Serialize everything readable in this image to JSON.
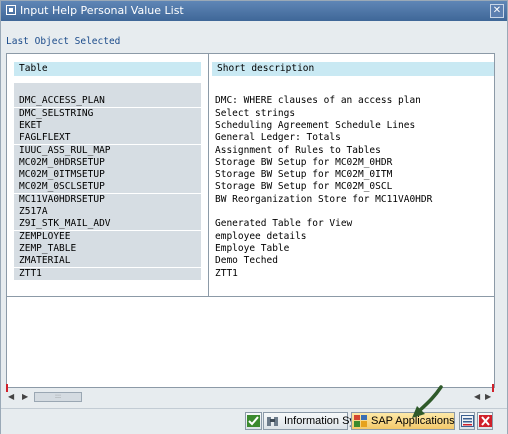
{
  "window": {
    "title": "Input Help Personal Value List"
  },
  "sublabel": "Last Object Selected",
  "table": {
    "headers": [
      "Table",
      "Short description"
    ],
    "rows": [
      {
        "name": "",
        "desc": ""
      },
      {
        "name": "DMC_ACCESS_PLAN",
        "desc": "DMC: WHERE clauses of an access plan"
      },
      {
        "name": "DMC_SELSTRING",
        "desc": "Select strings"
      },
      {
        "name": "EKET",
        "desc": "Scheduling Agreement Schedule Lines"
      },
      {
        "name": "FAGLFLEXT",
        "desc": "General Ledger: Totals"
      },
      {
        "name": "IUUC_ASS_RUL_MAP",
        "desc": "Assignment of Rules to Tables"
      },
      {
        "name": "MC02M_0HDRSETUP",
        "desc": "Storage BW Setup for MC02M_0HDR"
      },
      {
        "name": "MC02M_0ITMSETUP",
        "desc": "Storage BW Setup for MC02M_0ITM"
      },
      {
        "name": "MC02M_0SCLSETUP",
        "desc": "Storage BW Setup for MC02M_0SCL"
      },
      {
        "name": "MC11VA0HDRSETUP",
        "desc": "BW Reorganization Store for MC11VA0HDR"
      },
      {
        "name": "Z517A",
        "desc": ""
      },
      {
        "name": "Z9I_STK_MAIL_ADV",
        "desc": "Generated Table for View"
      },
      {
        "name": "ZEMPLOYEE",
        "desc": "employee details"
      },
      {
        "name": "ZEMP_TABLE",
        "desc": "Employe Table"
      },
      {
        "name": "ZMATERIAL",
        "desc": "Demo Teched"
      },
      {
        "name": "ZTT1",
        "desc": "ZTT1"
      }
    ]
  },
  "toolbar": {
    "info_label": "Information System",
    "sapapp_label": "SAP Applications"
  },
  "colors": {
    "titlebar": "#4a72a4",
    "header_cell": "#c9e9f3",
    "name_cell": "#d6dde3",
    "arrow": "#2f5a2a"
  },
  "icons": [
    "window-icon",
    "close-icon",
    "check-icon",
    "binoculars-icon",
    "sap-app-icon",
    "save-icon",
    "cancel-icon"
  ]
}
